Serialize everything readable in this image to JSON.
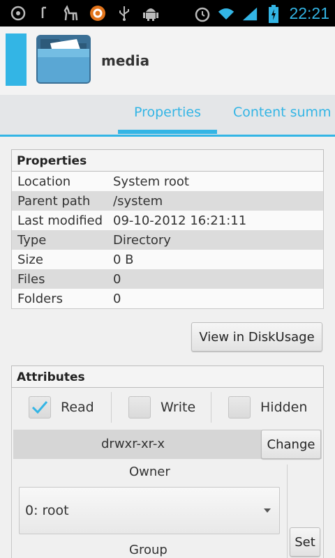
{
  "status_bar": {
    "time": "22:21",
    "icons": [
      "cyanogenmod-icon",
      "usb-debug-icon",
      "llama-icon",
      "circle-app-icon",
      "usb-icon",
      "android-debug-icon",
      "alarm-icon",
      "wifi-icon",
      "signal-icon",
      "battery-charging-icon"
    ]
  },
  "header": {
    "title": "media"
  },
  "tabs": [
    {
      "label": "Properties",
      "active": true
    },
    {
      "label": "Content summ",
      "active": false
    }
  ],
  "properties": {
    "heading": "Properties",
    "rows": [
      {
        "key": "Location",
        "value": "System root"
      },
      {
        "key": "Parent path",
        "value": "/system"
      },
      {
        "key": "Last modified",
        "value": "09-10-2012 16:21:11"
      },
      {
        "key": "Type",
        "value": "Directory"
      },
      {
        "key": "Size",
        "value": "0 B"
      },
      {
        "key": "Files",
        "value": "0"
      },
      {
        "key": "Folders",
        "value": "0"
      }
    ],
    "view_button": "View in DiskUsage"
  },
  "attributes": {
    "heading": "Attributes",
    "checks": [
      {
        "label": "Read",
        "checked": true
      },
      {
        "label": "Write",
        "checked": false
      },
      {
        "label": "Hidden",
        "checked": false
      }
    ],
    "permissions": "drwxr-xr-x",
    "change_button": "Change",
    "owner_label": "Owner",
    "owner_value": "0: root",
    "set_button": "Set",
    "group_label": "Group"
  },
  "colors": {
    "accent": "#33b5e5",
    "status_bg": "#000000",
    "folder": "#4b9fc9"
  }
}
